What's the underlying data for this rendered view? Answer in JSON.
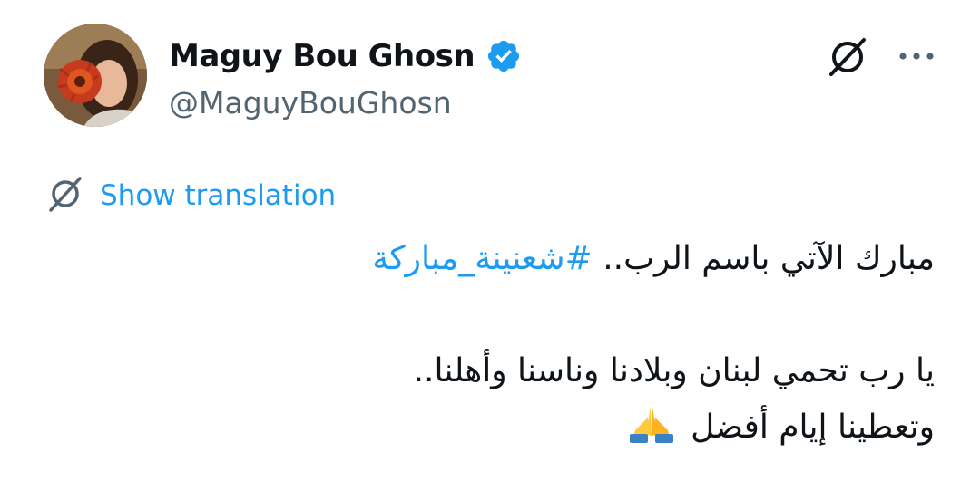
{
  "user": {
    "display_name": "Maguy Bou Ghosn",
    "handle": "@MaguyBouGhosn",
    "verified": true
  },
  "actions": {
    "translate_icon": "translate-icon",
    "more_icon": "more-icon"
  },
  "translation": {
    "label": "Show translation"
  },
  "tweet": {
    "line1_text": "مبارك الآتي باسم الرب.. ",
    "line1_hashtag": "#شعنينة_مباركة",
    "line3_text": "يا رب تحمي لبنان وبلادنا وناسنا وأهلنا..",
    "line4_text": "وتعطينا إيام أفضل ",
    "line4_emoji": "folded-hands-emoji"
  },
  "colors": {
    "link": "#1d9bf0",
    "secondary_text": "#536471",
    "primary_text": "#0f1419",
    "verified_badge": "#1d9bf0"
  }
}
